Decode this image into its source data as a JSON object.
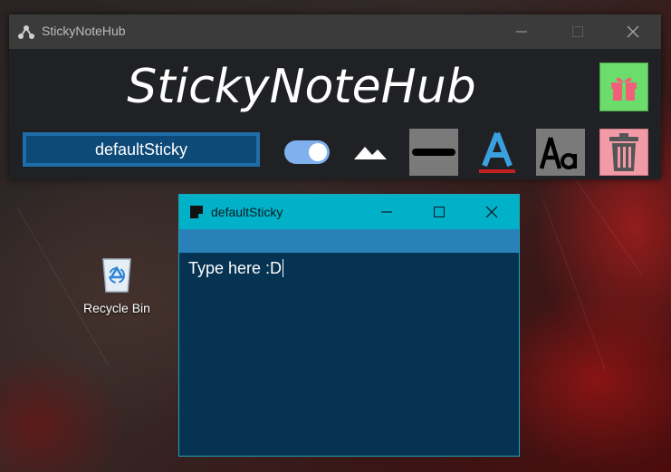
{
  "hub_window": {
    "title": "StickyNoteHub",
    "heading": "StickyNoteHub",
    "note_name_value": "defaultSticky",
    "toggle_on": true,
    "gift_color": "#6cdc6c",
    "delete_color": "#f29ba6",
    "accent_color": "#1f6ea9"
  },
  "desktop": {
    "recycle_bin_label": "Recycle Bin"
  },
  "note_window": {
    "title": "defaultSticky",
    "content": "Type here :D",
    "titlebar_color": "#00b1c7",
    "body_color": "#073353"
  },
  "icons": [
    "app-logo-icon",
    "gift-icon",
    "image-icon",
    "line-thickness-icon",
    "font-color-icon",
    "font-size-icon",
    "trash-icon",
    "recycle-bin-icon",
    "sticky-note-icon"
  ]
}
